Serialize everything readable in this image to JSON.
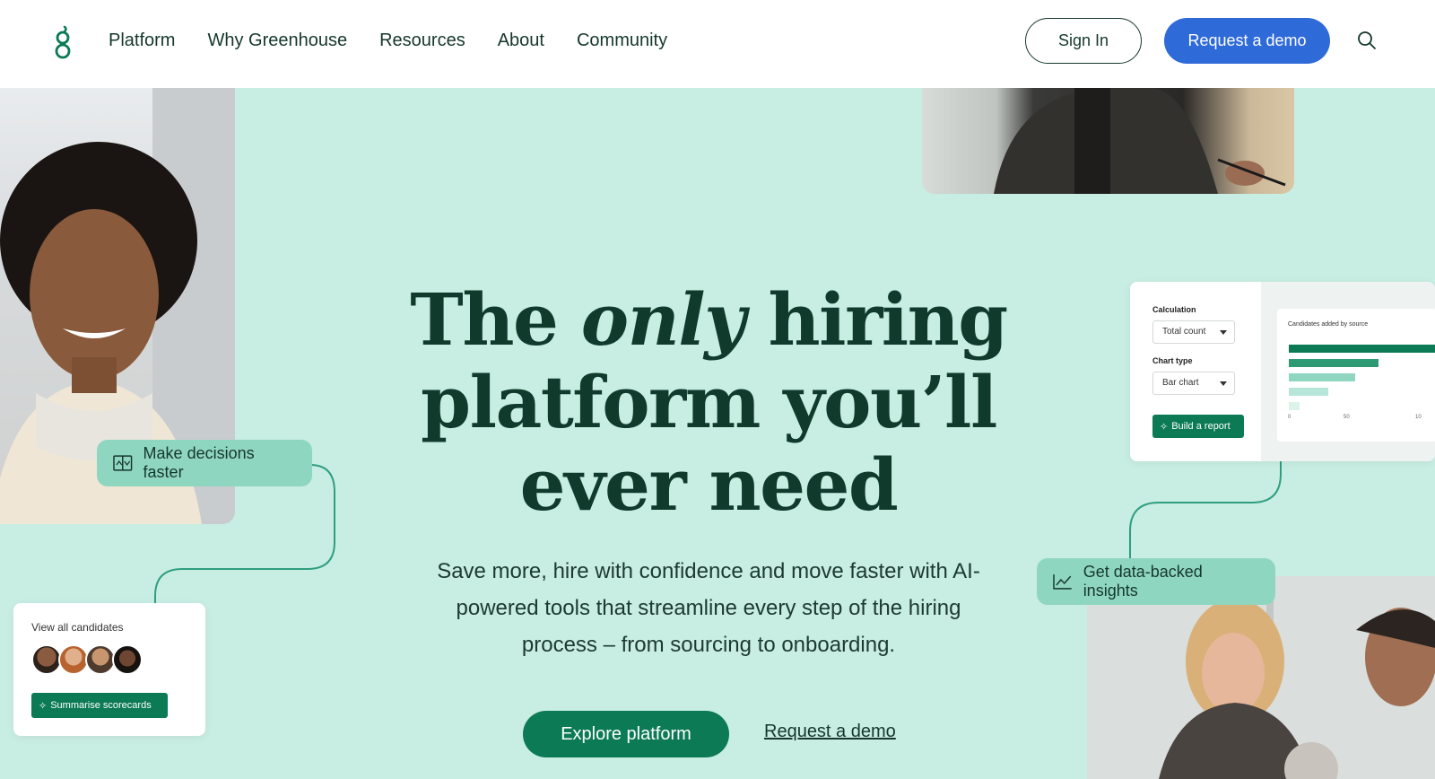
{
  "header": {
    "nav": [
      "Platform",
      "Why Greenhouse",
      "Resources",
      "About",
      "Community"
    ],
    "sign_in": "Sign In",
    "request_demo": "Request a demo"
  },
  "hero": {
    "title_pre": "The ",
    "title_em": "only",
    "title_post": " hiring platform you’ll ever need",
    "subtitle": "Save more, hire with confidence and move faster with AI-powered tools that streamline every step of the hiring process – from sourcing to onboarding.",
    "primary_cta": "Explore platform",
    "secondary_cta": "Request a demo"
  },
  "pills": {
    "decisions": "Make decisions faster",
    "insights": "Get data-backed insights"
  },
  "candidates_card": {
    "title": "View all candidates",
    "button": "Summarise scorecards"
  },
  "report_card": {
    "calculation_label": "Calculation",
    "calculation_value": "Total count",
    "chart_type_label": "Chart type",
    "chart_type_value": "Bar chart",
    "build_button": "Build a report",
    "chart_title": "Candidates added by source",
    "ticks": [
      "0",
      "50",
      "10"
    ]
  },
  "colors": {
    "background": "#c8ede2",
    "brand_green": "#0b7a55",
    "demo_blue": "#2f6ad9",
    "pill": "#8fd6c0"
  }
}
